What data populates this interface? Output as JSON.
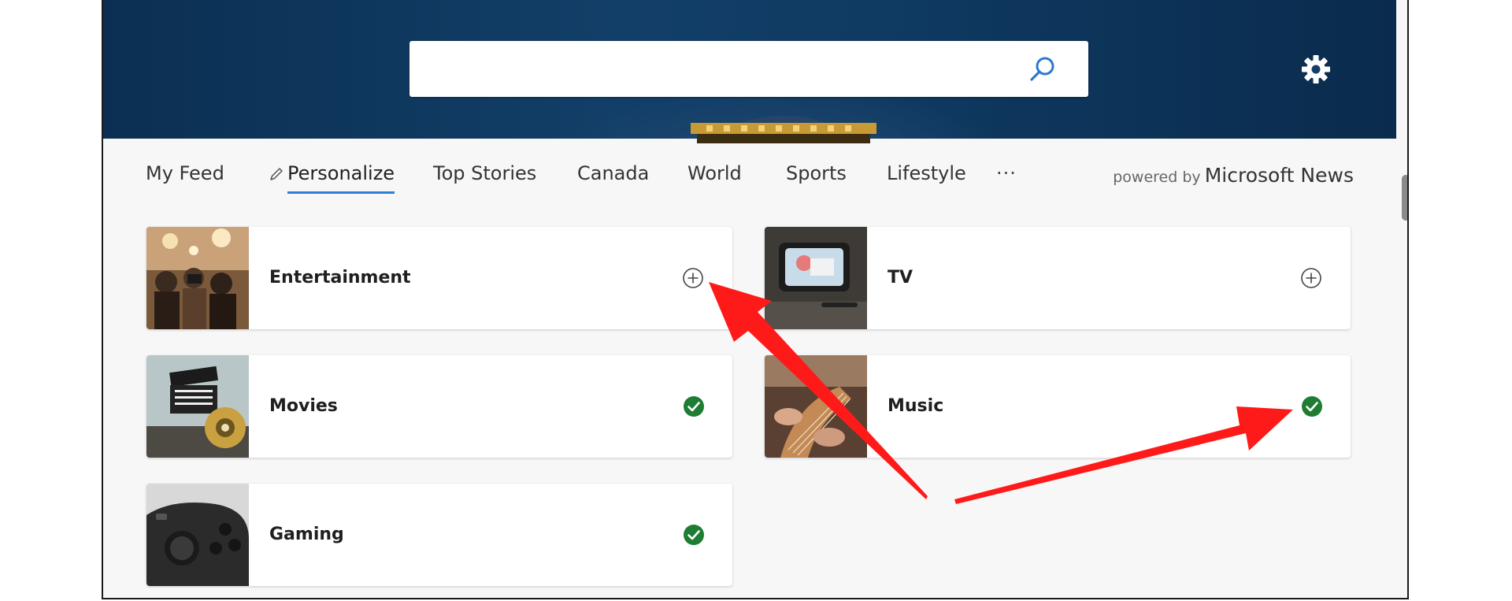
{
  "search": {
    "value": "",
    "placeholder": ""
  },
  "nav": {
    "items": [
      {
        "label": "My Feed"
      },
      {
        "label": "Personalize"
      },
      {
        "label": "Top Stories"
      },
      {
        "label": "Canada"
      },
      {
        "label": "World"
      },
      {
        "label": "Sports"
      },
      {
        "label": "Lifestyle"
      }
    ],
    "more_label": "···",
    "powered_by": "powered by",
    "brand": "Microsoft News"
  },
  "topics": [
    {
      "label": "Entertainment",
      "state": "add"
    },
    {
      "label": "TV",
      "state": "add"
    },
    {
      "label": "Movies",
      "state": "followed"
    },
    {
      "label": "Music",
      "state": "followed"
    },
    {
      "label": "Gaming",
      "state": "followed"
    }
  ],
  "colors": {
    "accent_underline": "#2f7fd8",
    "followed_check": "#1e7d32",
    "annotation_arrow": "#ff1a1a",
    "header_blue": "#123f68"
  },
  "icons": {
    "search": "search-icon",
    "settings": "gear-icon",
    "edit": "pencil-icon",
    "add": "add-circle-icon",
    "followed": "check-circle-icon"
  }
}
